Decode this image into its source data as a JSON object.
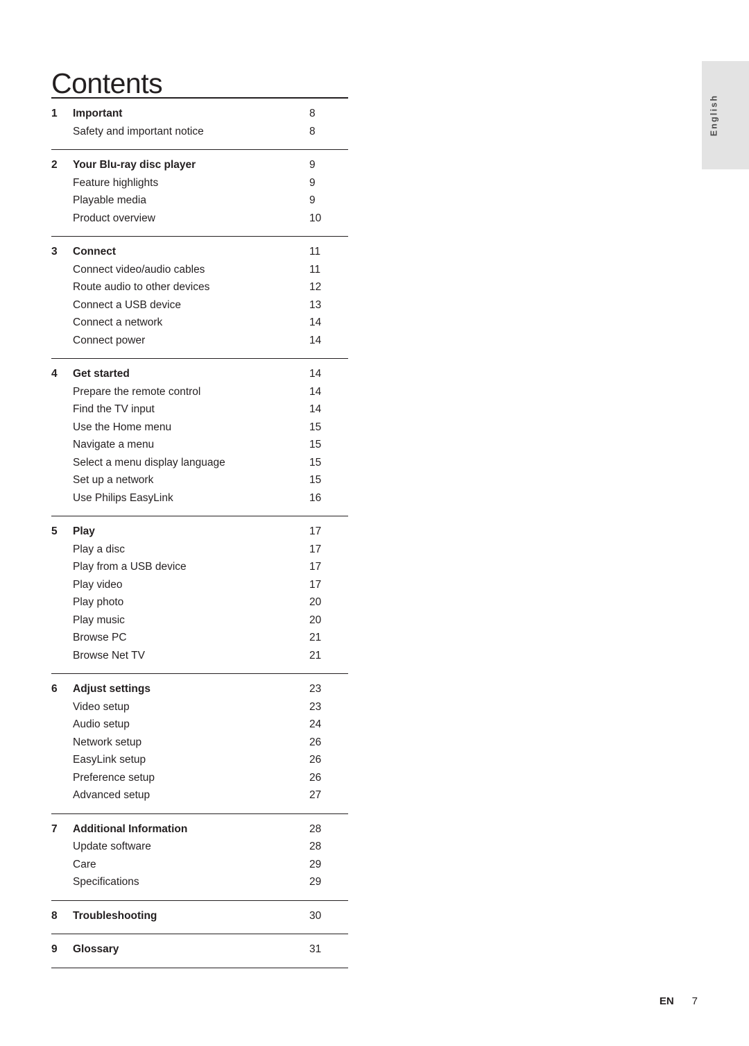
{
  "page": {
    "title": "Contents",
    "side_tab_label": "English",
    "footer_lang": "EN",
    "footer_page": "7"
  },
  "toc": {
    "groups": [
      {
        "number": "1",
        "title": "Important",
        "page": "8",
        "entries": [
          {
            "label": "Safety and important notice",
            "page": "8"
          }
        ]
      },
      {
        "number": "2",
        "title": "Your Blu-ray disc player",
        "page": "9",
        "entries": [
          {
            "label": "Feature highlights",
            "page": "9"
          },
          {
            "label": "Playable media",
            "page": "9"
          },
          {
            "label": "Product overview",
            "page": "10"
          }
        ]
      },
      {
        "number": "3",
        "title": "Connect",
        "page": "11",
        "entries": [
          {
            "label": "Connect video/audio cables",
            "page": "11"
          },
          {
            "label": "Route audio to other devices",
            "page": "12"
          },
          {
            "label": "Connect a USB device",
            "page": "13"
          },
          {
            "label": "Connect a network",
            "page": "14"
          },
          {
            "label": "Connect power",
            "page": "14"
          }
        ]
      },
      {
        "number": "4",
        "title": "Get started",
        "page": "14",
        "entries": [
          {
            "label": "Prepare the remote control",
            "page": "14"
          },
          {
            "label": "Find the TV input",
            "page": "14"
          },
          {
            "label": "Use the Home menu",
            "page": "15"
          },
          {
            "label": "Navigate a menu",
            "page": "15"
          },
          {
            "label": "Select a menu display language",
            "page": "15"
          },
          {
            "label": "Set up a network",
            "page": "15"
          },
          {
            "label": "Use Philips EasyLink",
            "page": "16"
          }
        ]
      },
      {
        "number": "5",
        "title": "Play",
        "page": "17",
        "entries": [
          {
            "label": "Play a disc",
            "page": "17"
          },
          {
            "label": "Play from a USB device",
            "page": "17"
          },
          {
            "label": "Play video",
            "page": "17"
          },
          {
            "label": "Play photo",
            "page": "20"
          },
          {
            "label": "Play music",
            "page": "20"
          },
          {
            "label": "Browse PC",
            "page": "21"
          },
          {
            "label": "Browse Net TV",
            "page": "21"
          }
        ]
      },
      {
        "number": "6",
        "title": "Adjust settings",
        "page": "23",
        "entries": [
          {
            "label": "Video setup",
            "page": "23"
          },
          {
            "label": "Audio setup",
            "page": "24"
          },
          {
            "label": "Network setup",
            "page": "26"
          },
          {
            "label": "EasyLink setup",
            "page": "26"
          },
          {
            "label": "Preference setup",
            "page": "26"
          },
          {
            "label": "Advanced setup",
            "page": "27"
          }
        ]
      },
      {
        "number": "7",
        "title": "Additional Information",
        "page": "28",
        "entries": [
          {
            "label": "Update software",
            "page": "28"
          },
          {
            "label": "Care",
            "page": "29"
          },
          {
            "label": "Specifications",
            "page": "29"
          }
        ]
      },
      {
        "number": "8",
        "title": "Troubleshooting",
        "page": "30",
        "entries": []
      },
      {
        "number": "9",
        "title": "Glossary",
        "page": "31",
        "entries": []
      }
    ]
  }
}
